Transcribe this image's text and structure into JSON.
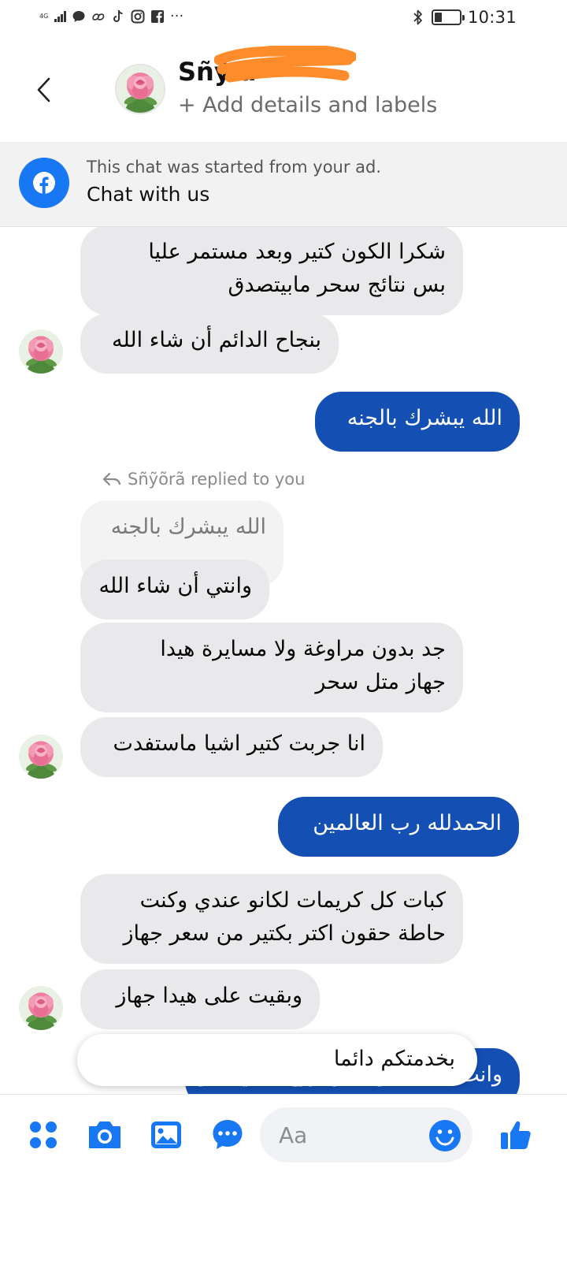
{
  "status_bar": {
    "network": "4G",
    "time": "10:31",
    "battery_level": 0.3,
    "more": "···",
    "icons": [
      "signal-icon",
      "chat-bubble-icon",
      "link-app-icon",
      "tiktok-icon",
      "instagram-icon",
      "facebook-icon",
      "bluetooth-icon",
      "battery-icon"
    ]
  },
  "header": {
    "contact_name": "Sñỹ      ã",
    "subtitle": "+ Add details and labels",
    "redaction_color": "#ff8c2a"
  },
  "ad_banner": {
    "subtitle": "This chat was started from your ad.",
    "title": "Chat with us"
  },
  "messages": [
    {
      "side": "in",
      "text": [
        "شكرا الكون كتير وبعد مستمر عليا",
        "بس نتائج سحر مابيتصدق"
      ]
    },
    {
      "side": "in",
      "text": [
        "بنجاح الدائم أن شاء الله"
      ]
    },
    {
      "side": "out",
      "text": [
        "الله يبشرك بالجنه"
      ]
    },
    {
      "side": "quote",
      "text": [
        "الله يبشرك بالجنه"
      ]
    },
    {
      "side": "in",
      "text": [
        "وانتي أن شاء الله"
      ]
    },
    {
      "side": "in",
      "text": [
        "جد بدون مراوغة ولا مسايرة هيدا",
        "جهاز متل سحر"
      ]
    },
    {
      "side": "in",
      "text": [
        "انا جربت كتير اشيا ماستفدت"
      ]
    },
    {
      "side": "out",
      "text": [
        "الحمدلله رب العالمين"
      ]
    },
    {
      "side": "in",
      "text": [
        "كبات كل كريمات لكانو عندي وكنت",
        "حاطة حقون اكتر بكتير من سعر جهاز"
      ]
    },
    {
      "side": "in",
      "text": [
        "وبقيت على هيدا جهاز"
      ]
    },
    {
      "side": "out",
      "text": [
        "وانت أيضا حبوبة من روح قلبي حلوة"
      ]
    }
  ],
  "replied_note": "Sñỹõrã replied to you",
  "suggestion": "بخدمتكم دائما",
  "composer": {
    "placeholder": "Aa",
    "accent": "#1877f2"
  },
  "colors": {
    "incoming_bubble": "#e9e9eb",
    "outgoing_bubble": "#1450b4",
    "facebook_blue": "#1877f2"
  }
}
